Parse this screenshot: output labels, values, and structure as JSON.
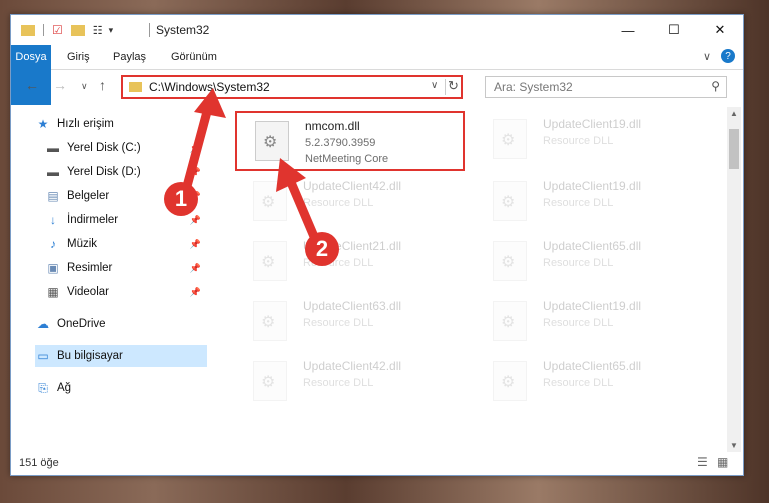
{
  "titlebar": {
    "title": "System32",
    "minimize": "—",
    "maximize": "☐",
    "close": "✕"
  },
  "ribbon": {
    "tabs": [
      "Dosya",
      "Giriş",
      "Paylaş",
      "Görünüm"
    ]
  },
  "address": {
    "path": "C:\\Windows\\System32",
    "search_placeholder": "Ara: System32"
  },
  "nav": {
    "items": [
      {
        "label": "Hızlı erişim",
        "icon": "star-icon"
      },
      {
        "label": "Yerel Disk (C:)",
        "icon": "drive-icon",
        "pinned": true
      },
      {
        "label": "Yerel Disk (D:)",
        "icon": "drive-icon",
        "pinned": true
      },
      {
        "label": "Belgeler",
        "icon": "documents-icon",
        "pinned": true
      },
      {
        "label": "İndirmeler",
        "icon": "download-icon",
        "pinned": true
      },
      {
        "label": "Müzik",
        "icon": "music-icon",
        "pinned": true
      },
      {
        "label": "Resimler",
        "icon": "pictures-icon",
        "pinned": true
      },
      {
        "label": "Videolar",
        "icon": "video-icon",
        "pinned": true
      },
      {
        "label": "OneDrive",
        "icon": "cloud-icon"
      },
      {
        "label": "Bu bilgisayar",
        "icon": "computer-icon"
      },
      {
        "label": "Ağ",
        "icon": "network-icon"
      }
    ]
  },
  "files": [
    {
      "name": "nmcom.dll",
      "version": "5.2.3790.3959",
      "desc": "NetMeeting Core"
    },
    {
      "name": "UpdateClient19.dll",
      "desc": "Resource DLL"
    },
    {
      "name": "UpdateClient42.dll",
      "desc": "Resource DLL"
    },
    {
      "name": "UpdateClient19.dll",
      "desc": "Resource DLL"
    },
    {
      "name": "UpdateClient21.dll",
      "desc": "Resource DLL"
    },
    {
      "name": "UpdateClient65.dll",
      "desc": "Resource DLL"
    },
    {
      "name": "UpdateClient63.dll",
      "desc": "Resource DLL"
    },
    {
      "name": "UpdateClient19.dll",
      "desc": "Resource DLL"
    },
    {
      "name": "UpdateClient42.dll",
      "desc": "Resource DLL"
    },
    {
      "name": "UpdateClient65.dll",
      "desc": "Resource DLL"
    }
  ],
  "status": {
    "count": "151 öğe"
  },
  "annotations": {
    "step1": "1",
    "step2": "2"
  },
  "colors": {
    "accent": "#1979ca",
    "highlight": "#e0342e",
    "selection": "#cde8ff"
  }
}
